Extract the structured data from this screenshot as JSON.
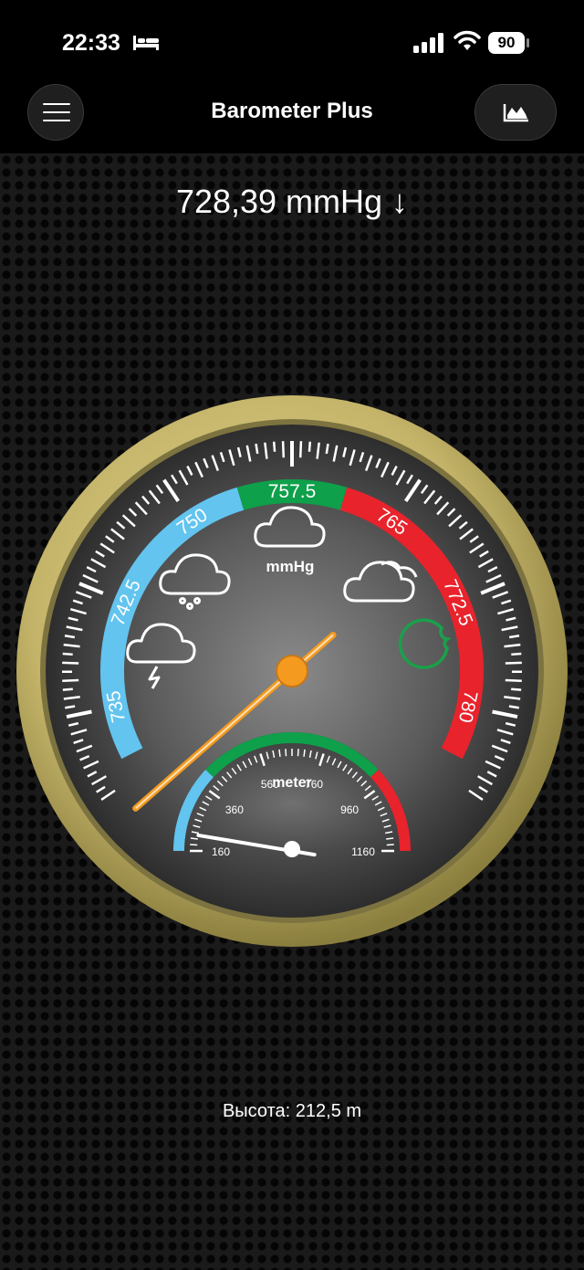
{
  "status_bar": {
    "time": "22:33",
    "battery": "90"
  },
  "nav": {
    "title": "Barometer Plus",
    "menu_icon": "hamburger-icon",
    "chart_icon": "area-chart-icon"
  },
  "reading": {
    "pressure_text": "728,39 mmHg ↓",
    "pressure_value": 728.39,
    "trend": "down"
  },
  "gauge": {
    "unit": "mmHg",
    "range": [
      730,
      785
    ],
    "labels": [
      "735",
      "742.5",
      "750",
      "757.5",
      "765",
      "772.5",
      "780"
    ],
    "needle_value": 728.39,
    "zones": [
      {
        "name": "low",
        "color": "#62c4ef"
      },
      {
        "name": "normal",
        "color": "#0ea04a"
      },
      {
        "name": "high",
        "color": "#e8232c"
      }
    ],
    "icons": [
      "storm-cloud-icon",
      "rain-cloud-icon",
      "cloud-icon",
      "partly-cloudy-icon",
      "sun-icon"
    ]
  },
  "altimeter": {
    "unit": "meter",
    "labels": [
      "160",
      "360",
      "560",
      "760",
      "960",
      "1160"
    ],
    "range": [
      160,
      1160
    ],
    "needle_value": 212.5
  },
  "altitude": {
    "text": "Высота: 212,5 m"
  }
}
